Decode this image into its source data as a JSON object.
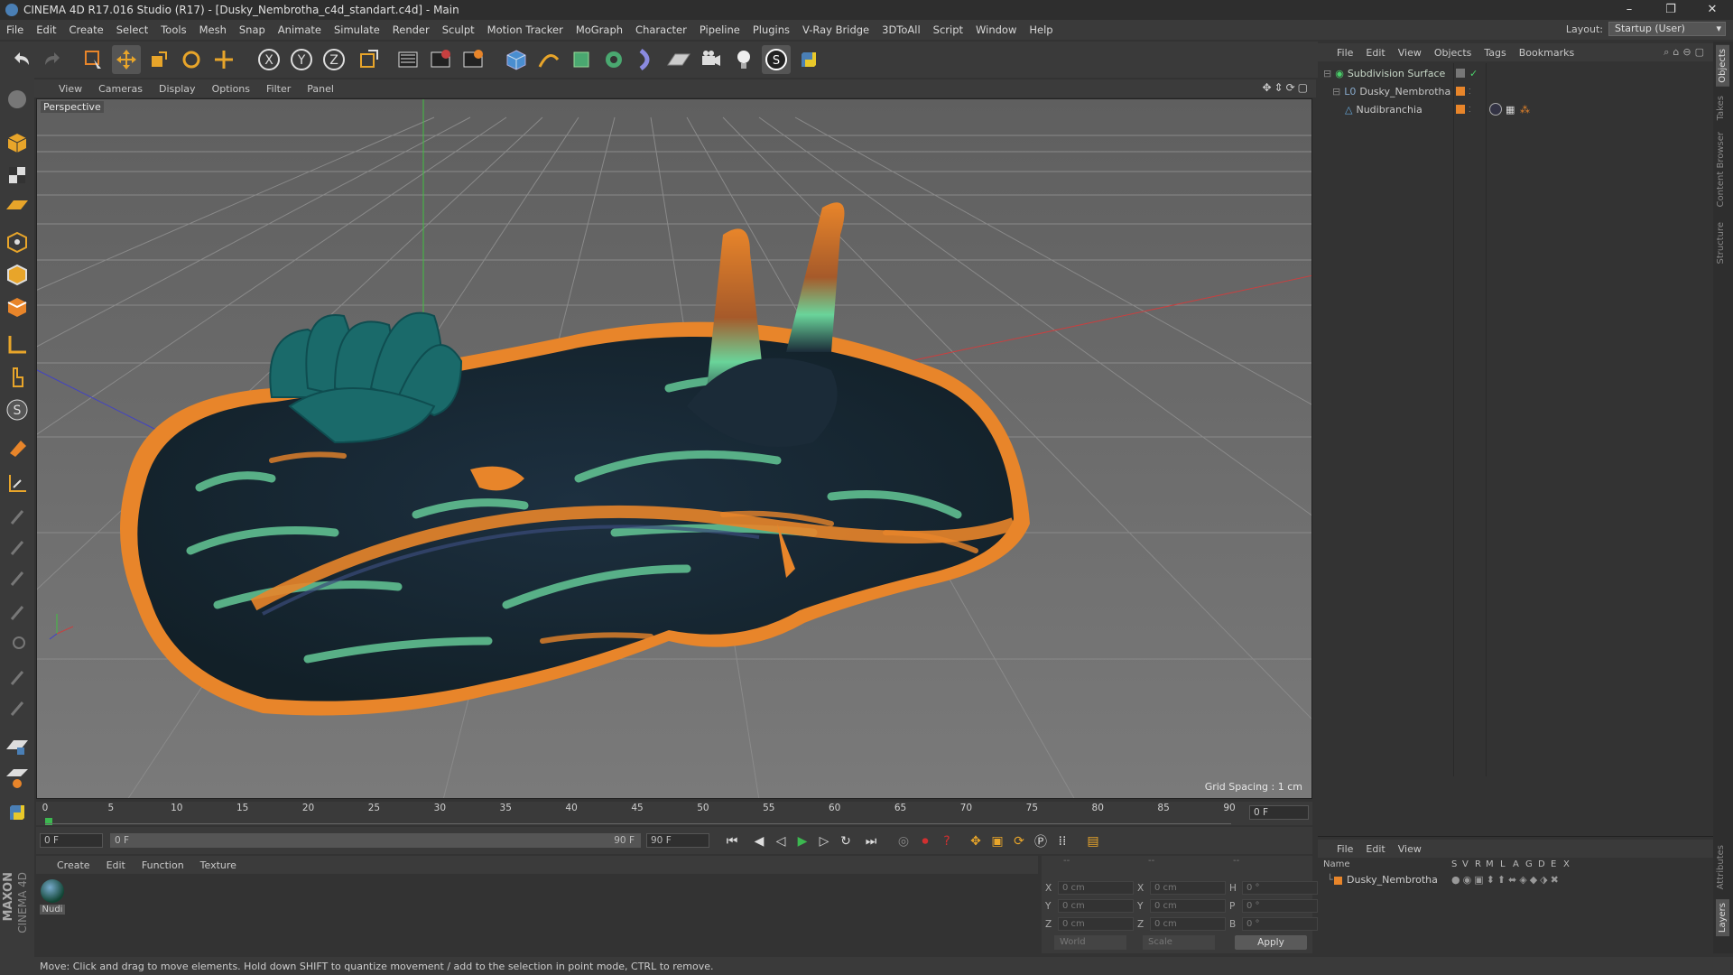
{
  "window": {
    "title": "CINEMA 4D R17.016 Studio (R17) - [Dusky_Nembrotha_c4d_standart.c4d] - Main",
    "controls": [
      "–",
      "❐",
      "✕"
    ]
  },
  "menubar": {
    "items": [
      "File",
      "Edit",
      "Create",
      "Select",
      "Tools",
      "Mesh",
      "Snap",
      "Animate",
      "Simulate",
      "Render",
      "Sculpt",
      "Motion Tracker",
      "MoGraph",
      "Character",
      "Pipeline",
      "Plugins",
      "V-Ray Bridge",
      "3DToAll",
      "Script",
      "Window",
      "Help"
    ],
    "layout_label": "Layout:",
    "layout_value": "Startup (User)"
  },
  "toolbar": {
    "icons": [
      "undo-icon",
      "redo-icon",
      "live-select-icon",
      "move-icon",
      "scale-icon",
      "rotate-icon",
      "recent-tool-icon",
      "x-axis-icon",
      "y-axis-icon",
      "z-axis-icon",
      "coordinate-system-icon",
      "render-view-icon",
      "render-picture-viewer-icon",
      "render-settings-icon",
      "cube-icon",
      "pen-spline-icon",
      "subdivision-icon",
      "array-icon",
      "deformer-icon",
      "floor-icon",
      "camera-icon",
      "light-icon",
      "vray-icon",
      "python-icon"
    ],
    "axis_labels": [
      "X",
      "Y",
      "Z"
    ]
  },
  "left_toolbar": {
    "icons": [
      "make-editable-icon",
      "model-mode-icon",
      "texture-mode-icon",
      "workplane-icon",
      "points-mode-icon",
      "edges-mode-icon",
      "polygons-mode-icon",
      "axis-mode-icon",
      "tweak-icon",
      "snap-icon",
      "magnet-icon",
      "sculpt-icon",
      "brush-icon",
      "brush-2-icon",
      "brush-3-icon",
      "brush-4-icon",
      "brush-5-icon",
      "brush-6-icon",
      "brush-7-icon",
      "workplane-lock-icon",
      "solo-icon",
      "python-script-icon"
    ]
  },
  "viewport": {
    "menu": [
      "View",
      "Cameras",
      "Display",
      "Options",
      "Filter",
      "Panel"
    ],
    "camera_label": "Perspective",
    "grid_spacing": "Grid Spacing : 1 cm"
  },
  "timeline": {
    "ticks": [
      "0",
      "5",
      "10",
      "15",
      "20",
      "25",
      "30",
      "35",
      "40",
      "45",
      "50",
      "55",
      "60",
      "65",
      "70",
      "75",
      "80",
      "85",
      "90"
    ],
    "current_frame": "0 F"
  },
  "transport": {
    "start_field": "0 F",
    "range_start": "0 F",
    "range_end": "90 F",
    "end_field": "90 F"
  },
  "material_manager": {
    "menu": [
      "Create",
      "Edit",
      "Function",
      "Texture"
    ],
    "materials": [
      {
        "name": "Nudi"
      }
    ]
  },
  "coordinates": {
    "header": [
      "--",
      "--",
      "--"
    ],
    "rows": [
      {
        "a": "X",
        "av": "0 cm",
        "b": "X",
        "bv": "0 cm",
        "c": "H",
        "cv": "0 °"
      },
      {
        "a": "Y",
        "av": "0 cm",
        "b": "Y",
        "bv": "0 cm",
        "c": "P",
        "cv": "0 °"
      },
      {
        "a": "Z",
        "av": "0 cm",
        "b": "Z",
        "bv": "0 cm",
        "c": "B",
        "cv": "0 °"
      }
    ],
    "mode1": "World",
    "mode2": "Scale",
    "apply": "Apply"
  },
  "object_manager": {
    "menu": [
      "File",
      "Edit",
      "View",
      "Objects",
      "Tags",
      "Bookmarks"
    ],
    "objects": [
      {
        "name": "Subdivision Surface",
        "level": 0
      },
      {
        "name": "Dusky_Nembrotha",
        "level": 1
      },
      {
        "name": "Nudibranchia",
        "level": 2
      }
    ]
  },
  "attribute_manager": {
    "menu": [
      "File",
      "Edit",
      "View"
    ],
    "columns": [
      "Name",
      "S",
      "V",
      "R",
      "M",
      "L",
      "A",
      "G",
      "D",
      "E",
      "X"
    ],
    "rows": [
      {
        "name": "Dusky_Nembrotha"
      }
    ]
  },
  "side_tabs": [
    "Objects",
    "Takes",
    "Content Browser",
    "Structure",
    "Attributes",
    "Layers"
  ],
  "brand": {
    "maxon": "MAXON",
    "c4d": "CINEMA 4D"
  },
  "status": "Move: Click and drag to move elements. Hold down SHIFT to quantize movement / add to the selection in point mode, CTRL to remove.",
  "colors": {
    "accent": "#e8852a",
    "teal": "#1e6a6a",
    "green": "#64c896",
    "viewport": "#6b6b6b",
    "axis_x": "#c84040",
    "axis_y": "#40c040",
    "axis_z": "#4040c8"
  }
}
